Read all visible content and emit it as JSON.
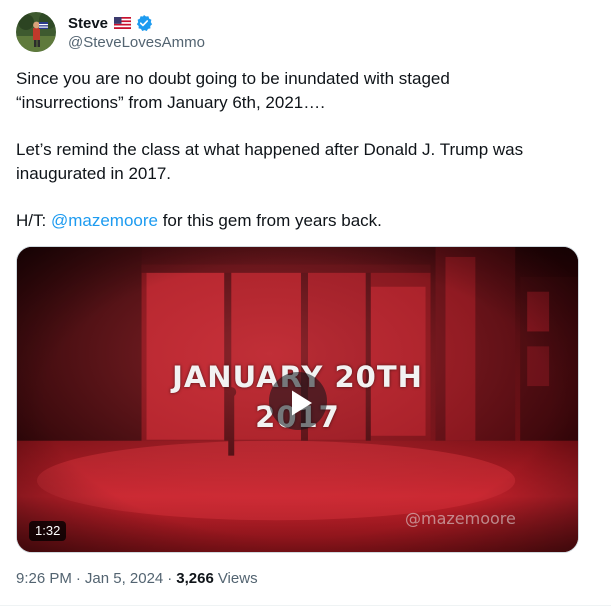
{
  "author": {
    "display_name": "Steve",
    "handle": "@SteveLovesAmmo",
    "flag_emoji": "🇺🇸",
    "verified": true,
    "verified_color": "#1d9bf0"
  },
  "tweet": {
    "line1": "Since you are no doubt going to be inundated with staged",
    "line2": "“insurrections” from January 6th, 2021….",
    "line3": "Let’s remind the class at what happened after Donald J. Trump was",
    "line4": "inaugurated in 2017.",
    "ht_prefix": "H/T: ",
    "mention": "@mazemoore",
    "ht_suffix": " for this gem from years back."
  },
  "video": {
    "title_line1": "JANUARY 20TH",
    "title_line2": "2017",
    "duration": "1:32",
    "watermark": "@mazemoore",
    "tint_color": "#b3121a"
  },
  "meta": {
    "time": "9:26 PM",
    "separator": "·",
    "date": "Jan 5, 2024",
    "views_count": "3,266",
    "views_label": "Views"
  },
  "colors": {
    "text_primary": "#0f1419",
    "text_secondary": "#536471",
    "link": "#1d9bf0"
  }
}
